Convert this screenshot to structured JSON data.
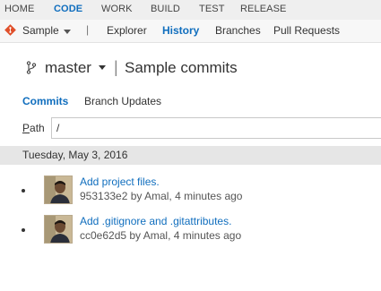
{
  "top_nav": {
    "tabs": [
      {
        "label": "HOME",
        "active": false
      },
      {
        "label": "CODE",
        "active": true
      },
      {
        "label": "WORK",
        "active": false
      },
      {
        "label": "BUILD",
        "active": false
      },
      {
        "label": "TEST",
        "active": false
      },
      {
        "label": "RELEASE",
        "active": false
      }
    ]
  },
  "sub_nav": {
    "repo_icon": "git-diamond-icon",
    "repo_name": "Sample",
    "separator": "|",
    "items": [
      {
        "label": "Explorer",
        "active": false
      },
      {
        "label": "History",
        "active": true
      },
      {
        "label": "Branches",
        "active": false
      },
      {
        "label": "Pull Requests",
        "active": false
      }
    ]
  },
  "branch": {
    "icon": "branch-icon",
    "name": "master",
    "separator": "|",
    "page_title": "Sample commits"
  },
  "pivots": [
    {
      "label": "Commits",
      "active": true
    },
    {
      "label": "Branch Updates",
      "active": false
    }
  ],
  "path_filter": {
    "label_prefix": "P",
    "label_rest": "ath",
    "value": "/"
  },
  "date_group": "Tuesday, May 3, 2016",
  "commits": [
    {
      "title": "Add project files.",
      "meta": "953133e2 by Amal, 4 minutes ago"
    },
    {
      "title": "Add .gitignore and .gitattributes.",
      "meta": "cc0e62d5 by Amal, 4 minutes ago"
    }
  ],
  "colors": {
    "accent": "#106ebe",
    "repo_icon": "#e0502b"
  }
}
